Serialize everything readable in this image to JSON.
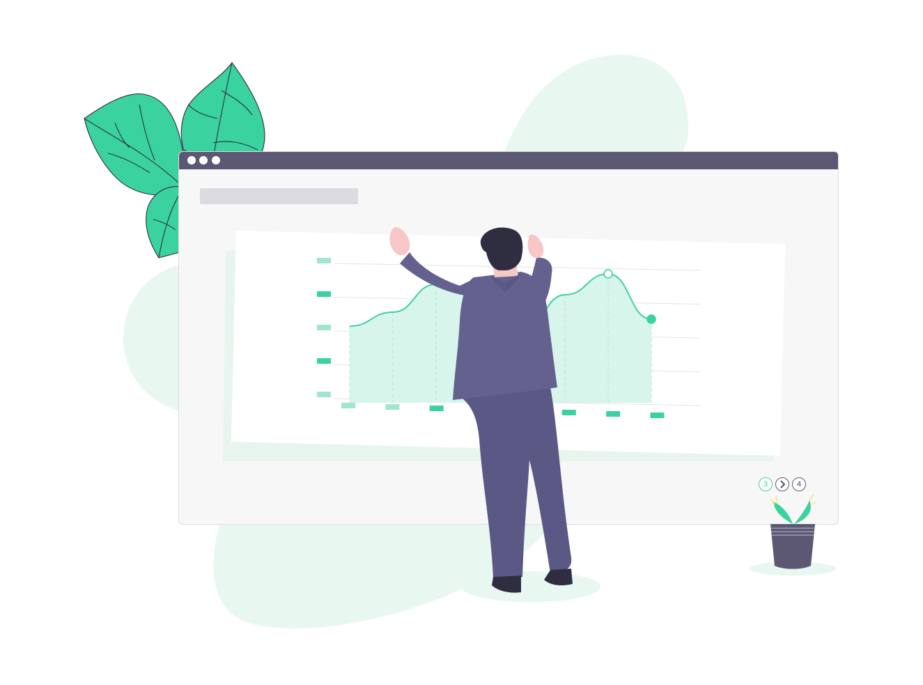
{
  "colors": {
    "accent": "#3ad29f",
    "titlebar": "#5c5873",
    "suit": "#64618f",
    "blob": "#e8f8f1"
  },
  "pagination": {
    "current": "3",
    "next": "4",
    "next_icon": "chevron-right-icon"
  },
  "chart_data": {
    "type": "area",
    "title": "",
    "xlabel": "",
    "ylabel": "",
    "series": [
      {
        "values": [
          2.2,
          2.6,
          3.4,
          3.0,
          2.0,
          3.1,
          3.7,
          2.4
        ]
      }
    ],
    "markers": [
      {
        "index": 6,
        "style": "hollow"
      },
      {
        "index": 7,
        "style": "filled"
      }
    ],
    "ylim": [
      0,
      4
    ],
    "grid": true,
    "legend": "none"
  }
}
